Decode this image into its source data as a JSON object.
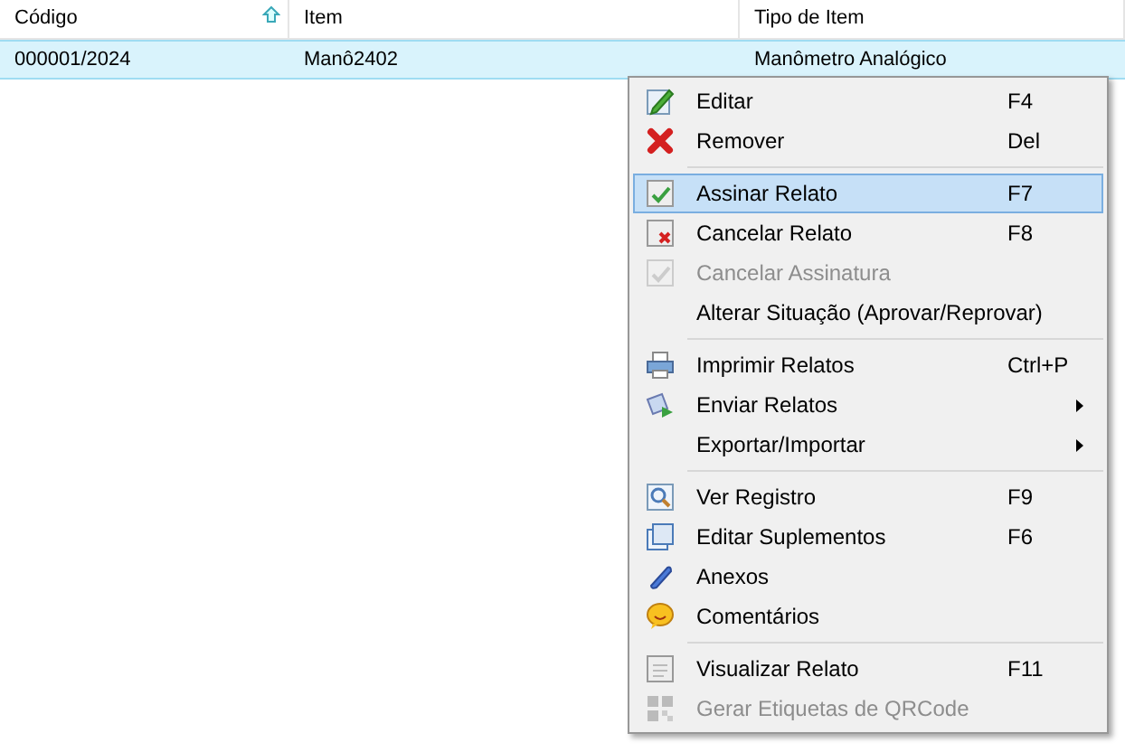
{
  "table": {
    "columns": [
      {
        "label": "Código",
        "sorted": true
      },
      {
        "label": "Item",
        "sorted": false
      },
      {
        "label": "Tipo de Item",
        "sorted": false
      }
    ],
    "rows": [
      {
        "cells": [
          "000001/2024",
          "Manô2402",
          "Manômetro Analógico"
        ],
        "selected": true
      }
    ]
  },
  "context_menu": {
    "entries": [
      {
        "kind": "item",
        "label": "Editar",
        "shortcut": "F4",
        "selected": false,
        "disabled": false,
        "submenu": false
      },
      {
        "kind": "item",
        "label": "Remover",
        "shortcut": "Del",
        "selected": false,
        "disabled": false,
        "submenu": false
      },
      {
        "kind": "separator"
      },
      {
        "kind": "item",
        "label": "Assinar Relato",
        "shortcut": "F7",
        "selected": true,
        "disabled": false,
        "submenu": false
      },
      {
        "kind": "item",
        "label": "Cancelar Relato",
        "shortcut": "F8",
        "selected": false,
        "disabled": false,
        "submenu": false
      },
      {
        "kind": "item",
        "label": "Cancelar Assinatura",
        "selected": false,
        "disabled": true,
        "submenu": false
      },
      {
        "kind": "item",
        "label": "Alterar Situação (Aprovar/Reprovar)",
        "selected": false,
        "disabled": false,
        "submenu": false
      },
      {
        "kind": "separator"
      },
      {
        "kind": "item",
        "label": "Imprimir Relatos",
        "shortcut": "Ctrl+P",
        "selected": false,
        "disabled": false,
        "submenu": false
      },
      {
        "kind": "item",
        "label": "Enviar Relatos",
        "selected": false,
        "disabled": false,
        "submenu": true
      },
      {
        "kind": "item",
        "label": "Exportar/Importar",
        "selected": false,
        "disabled": false,
        "submenu": true
      },
      {
        "kind": "separator"
      },
      {
        "kind": "item",
        "label": "Ver Registro",
        "shortcut": "F9",
        "selected": false,
        "disabled": false,
        "submenu": false
      },
      {
        "kind": "item",
        "label": "Editar Suplementos",
        "shortcut": "F6",
        "selected": false,
        "disabled": false,
        "submenu": false
      },
      {
        "kind": "item",
        "label": "Anexos",
        "selected": false,
        "disabled": false,
        "submenu": false
      },
      {
        "kind": "item",
        "label": "Comentários",
        "selected": false,
        "disabled": false,
        "submenu": false
      },
      {
        "kind": "separator"
      },
      {
        "kind": "item",
        "label": "Visualizar Relato",
        "shortcut": "F11",
        "selected": false,
        "disabled": false,
        "submenu": false
      },
      {
        "kind": "item",
        "label": "Gerar Etiquetas de QRCode",
        "selected": false,
        "disabled": true,
        "submenu": false
      }
    ]
  }
}
